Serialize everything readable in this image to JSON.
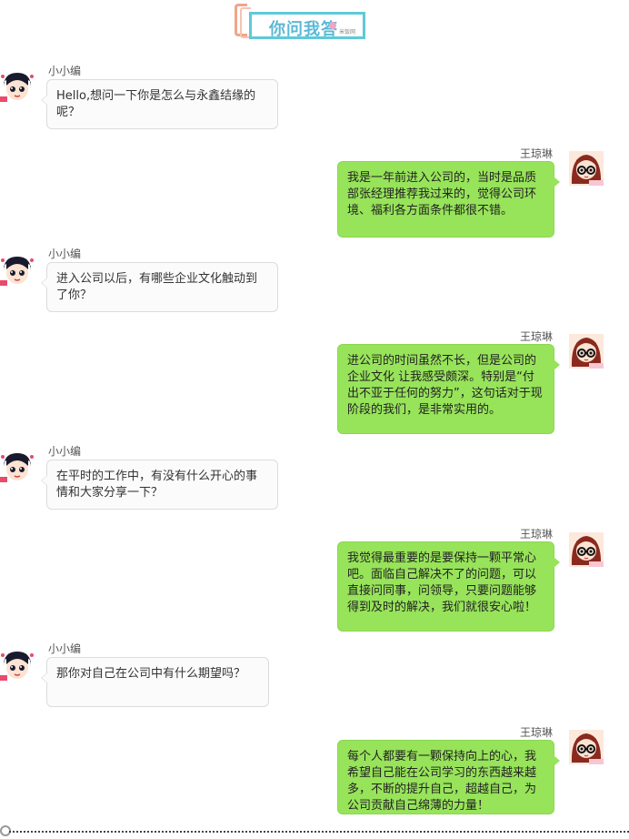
{
  "header": {
    "title": "你问我答",
    "subtitle": "米饭网"
  },
  "participants": {
    "interviewer": "小小编",
    "interviewee": "王琼琳"
  },
  "messages": [
    {
      "side": "left",
      "sender": "小小编",
      "text": "Hello,想问一下你是怎么与永鑫结缘的呢？"
    },
    {
      "side": "right",
      "sender": "王琼琳",
      "text": "我是一年前进入公司的，当时是品质部张经理推荐我过来的，觉得公司环境、福利各方面条件都很不错。"
    },
    {
      "side": "left",
      "sender": "小小编",
      "text": "进入公司以后，有哪些企业文化触动到了你？"
    },
    {
      "side": "right",
      "sender": "王琼琳",
      "text": "进公司的时间虽然不长，但是公司的企业文化 让我感受颇深。特别是“付出不亚于任何的努力”，这句话对于现阶段的我们，是非常实用的。"
    },
    {
      "side": "left",
      "sender": "小小编",
      "text": "在平时的工作中，有没有什么开心的事情和大家分享一下？"
    },
    {
      "side": "right",
      "sender": "王琼琳",
      "text": "我觉得最重要的是要保持一颗平常心吧。面临自己解决不了的问题，可以直接问同事，问领导，只要问题能够得到及时的解决，我们就很安心啦！"
    },
    {
      "side": "left",
      "sender": "小小编",
      "text": "那你对自己在公司中有什么期望吗？"
    },
    {
      "side": "right",
      "sender": "王琼琳",
      "text": "每个人都要有一颗保持向上的心，我希望自己能在公司学习的东西越来越多，不断的提升自己，超越自己，为公司贡献自己绵薄的力量！"
    }
  ],
  "colors": {
    "right_bubble": "#97e35a",
    "left_bubble": "#fbfbfb",
    "header_accent": "#5fc9d9",
    "header_frame": "#f0a58a"
  }
}
